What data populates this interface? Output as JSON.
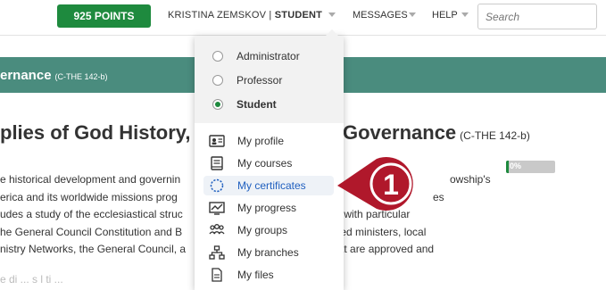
{
  "header": {
    "points": "925 POINTS",
    "user_name": "KRISTINA ZEMSKOV",
    "separator": " | ",
    "user_role": "STUDENT",
    "messages": "MESSAGES",
    "help": "HELP",
    "search_placeholder": "Search"
  },
  "course": {
    "band_title": "ernance",
    "band_code": "(C-THE 142-b)",
    "heading_left": "plies of God History,",
    "heading_right": "Governance",
    "heading_code": "(C-THE 142-b)",
    "paragraph_left": [
      "e historical development and governin",
      "erica and its worldwide missions prog",
      "udes a study of the ecclesiastical struc",
      "he General Council Constitution and B",
      "nistry Networks, the General Council, a"
    ],
    "paragraph_right": [
      "owship's",
      "es",
      "d, with particular",
      "aled ministers, local",
      "hat are approved and"
    ],
    "faded_line": "e   di    ...   s      l   ti   ...",
    "progress_label": "0%",
    "progress_value": 0.03
  },
  "dropdown": {
    "roles": [
      {
        "label": "Administrator",
        "checked": false
      },
      {
        "label": "Professor",
        "checked": false
      },
      {
        "label": "Student",
        "checked": true
      }
    ],
    "items": [
      {
        "label": "My profile",
        "icon": "id-card-icon"
      },
      {
        "label": "My courses",
        "icon": "book-icon"
      },
      {
        "label": "My certificates",
        "icon": "certificate-icon",
        "highlighted": true
      },
      {
        "label": "My progress",
        "icon": "progress-chart-icon"
      },
      {
        "label": "My groups",
        "icon": "people-icon"
      },
      {
        "label": "My branches",
        "icon": "sitemap-icon"
      },
      {
        "label": "My files",
        "icon": "file-icon"
      }
    ]
  },
  "callout": {
    "number": "1",
    "color": "#b0182b"
  },
  "colors": {
    "brand_green": "#1e8a3e",
    "band_teal": "#4a8c7e",
    "highlight_blue": "#1f5fbf"
  }
}
